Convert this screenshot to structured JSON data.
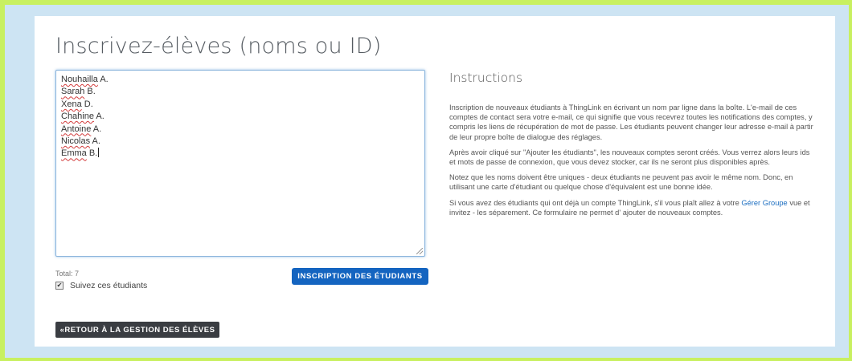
{
  "page": {
    "title": "Inscrivez-élèves (noms ou ID)"
  },
  "names_input": {
    "lines": [
      {
        "first": "Nouhailla",
        "rest": " A."
      },
      {
        "first": "Sarah",
        "rest": " B."
      },
      {
        "first": "Xena",
        "rest": " D."
      },
      {
        "first": "Chahine",
        "rest": " A."
      },
      {
        "first": "Antoine",
        "rest": " A."
      },
      {
        "first": "Nicolas",
        "rest": " A."
      },
      {
        "first": "Emma",
        "rest": " B."
      }
    ]
  },
  "total_label": "Total: 7",
  "follow_checkbox": {
    "label": "Suivez ces étudiants",
    "checked": true
  },
  "enroll_button_label": "INSCRIPTION DES ÉTUDIANTS",
  "instructions": {
    "heading": "Instructions",
    "p1": "Inscription de nouveaux étudiants à ThingLink en écrivant un nom par ligne dans la boîte. L'e-mail de ces comptes de contact sera votre e-mail, ce qui signifie que vous recevrez toutes les notifications des comptes, y compris les liens de récupération de mot de passe. Les étudiants peuvent changer leur adresse e-mail à partir de leur propre boîte de dialogue des réglages.",
    "p2": "Après avoir cliqué sur \"Ajouter les étudiants\", les nouveaux comptes seront créés. Vous verrez alors leurs ids et mots de passe de connexion, que vous devez stocker, car ils ne seront plus disponibles après.",
    "p3": "Notez que les noms doivent être uniques - deux étudiants ne peuvent pas avoir le même nom. Donc, en utilisant une carte d'étudiant ou quelque chose d'équivalent est une bonne idée.",
    "p4_before": "Si vous avez des étudiants qui ont déjà un compte ThingLink, s'il vous plaît allez à votre ",
    "p4_link": "Gérer Groupe",
    "p4_after": " vue et invitez - les séparement. Ce formulaire ne permet d' ajouter de nouveaux comptes."
  },
  "back_button_label": "«RETOUR À LA GESTION DES ÉLÈVES",
  "colors": {
    "outer_border": "#c8f060",
    "frame_background": "#cde4f3",
    "primary_button": "#1464c0",
    "dark_button": "#3a3d42",
    "link": "#1a6dc0"
  }
}
